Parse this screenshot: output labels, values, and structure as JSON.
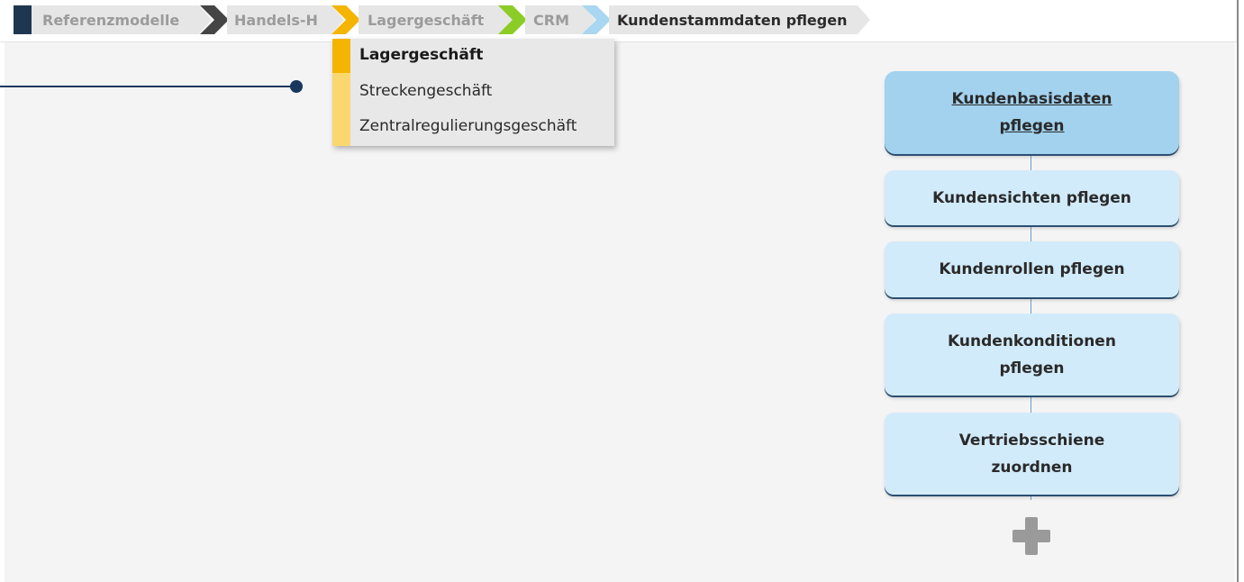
{
  "breadcrumb": {
    "items": [
      {
        "label": "Referenzmodelle",
        "marker_color": "#1f3650"
      },
      {
        "label": "Handels-H",
        "marker_color": "#454545"
      },
      {
        "label": "Lagergeschäft",
        "marker_color": "#f4b400"
      },
      {
        "label": "CRM",
        "marker_color": "#8ccc26"
      },
      {
        "label": "Kundenstammdaten pflegen",
        "marker_color": "#a9d6f0"
      }
    ]
  },
  "dropdown": {
    "items": [
      {
        "label": "Lagergeschäft",
        "selected": true
      },
      {
        "label": "Streckengeschäft",
        "selected": false
      },
      {
        "label": "Zentralregulierungsgeschäft",
        "selected": false
      }
    ]
  },
  "process": {
    "steps": [
      {
        "line1": "Kundenbasisdaten",
        "line2": "pflegen",
        "highlighted": true
      },
      {
        "line1": "Kundensichten pflegen",
        "line2": "",
        "highlighted": false
      },
      {
        "line1": "Kundenrollen pflegen",
        "line2": "",
        "highlighted": false
      },
      {
        "line1": "Kundenkonditionen",
        "line2": "pflegen",
        "highlighted": false
      },
      {
        "line1": "Vertriebsschiene",
        "line2": "zuordnen",
        "highlighted": false
      }
    ],
    "add_icon": "plus-icon"
  },
  "colors": {
    "connector": "#17375e",
    "box_fill": "#d2ebfa",
    "box_highlight": "#a2d2ee"
  }
}
